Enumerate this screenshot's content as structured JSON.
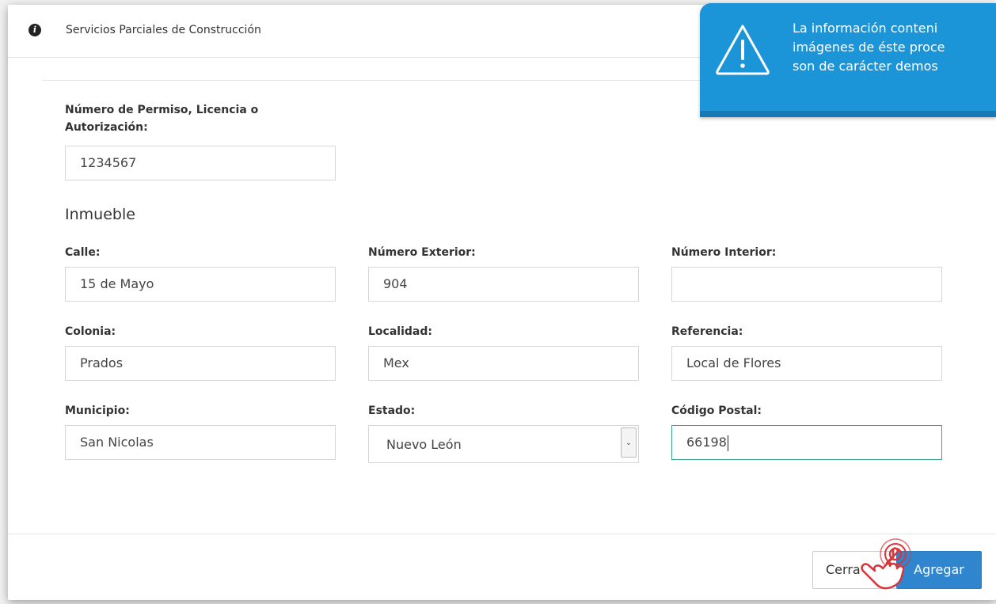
{
  "modal": {
    "title": "Servicios Parciales de Construcción"
  },
  "form": {
    "permit": {
      "label_line1": "Número de Permiso, Licencia o",
      "label_line2": "Autorización:",
      "value": "1234567"
    },
    "section_title": "Inmueble",
    "calle": {
      "label": "Calle:",
      "value": "15 de Mayo"
    },
    "numero_exterior": {
      "label": "Número Exterior:",
      "value": "904"
    },
    "numero_interior": {
      "label": "Número Interior:",
      "value": ""
    },
    "colonia": {
      "label": "Colonia:",
      "value": "Prados"
    },
    "localidad": {
      "label": "Localidad:",
      "value": "Mex"
    },
    "referencia": {
      "label": "Referencia:",
      "value": "Local de Flores"
    },
    "municipio": {
      "label": "Municipio:",
      "value": "San Nicolas"
    },
    "estado": {
      "label": "Estado:",
      "value": "Nuevo León"
    },
    "codigo_postal": {
      "label": "Código Postal:",
      "value": "66198"
    }
  },
  "footer": {
    "close_label": "Cerra",
    "add_label": "Agregar"
  },
  "banner": {
    "line1": "La información conteni",
    "line2": "imágenes de éste proce",
    "line3": "son de carácter  demos"
  },
  "colors": {
    "banner_bg": "#1b95d8",
    "primary_button": "#2f86cf",
    "focus_border": "#3aa58e",
    "hand_pointer": "#d9343a"
  }
}
